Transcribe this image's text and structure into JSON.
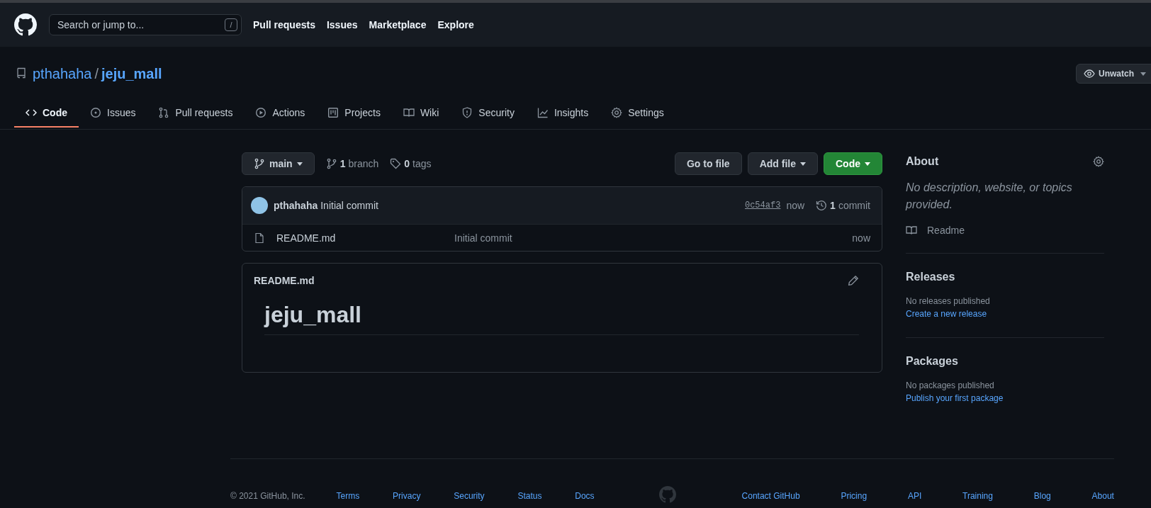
{
  "header": {
    "search": {
      "placeholder": "Search or jump to...",
      "key": "/"
    },
    "nav": [
      "Pull requests",
      "Issues",
      "Marketplace",
      "Explore"
    ]
  },
  "repo": {
    "owner": "pthahaha",
    "separator": "/",
    "name": "jeju_mall",
    "watch_button": "Unwatch"
  },
  "tabs": [
    {
      "label": "Code",
      "selected": true
    },
    {
      "label": "Issues",
      "selected": false
    },
    {
      "label": "Pull requests",
      "selected": false
    },
    {
      "label": "Actions",
      "selected": false
    },
    {
      "label": "Projects",
      "selected": false
    },
    {
      "label": "Wiki",
      "selected": false
    },
    {
      "label": "Security",
      "selected": false
    },
    {
      "label": "Insights",
      "selected": false
    },
    {
      "label": "Settings",
      "selected": false
    }
  ],
  "branch_bar": {
    "branch": "main",
    "branch_count": "1",
    "branch_label": "branch",
    "tag_count": "0",
    "tag_label": "tags",
    "buttons": [
      {
        "label": "Go to file",
        "kind": "plain"
      },
      {
        "label": "Add file",
        "kind": "dropdown"
      },
      {
        "label": "Code",
        "kind": "primary"
      }
    ]
  },
  "commit": {
    "author": "pthahaha",
    "message": "Initial commit",
    "sha": "0c54af3",
    "time": "now",
    "count": "1",
    "count_label": "commit"
  },
  "files": [
    {
      "name": "README.md",
      "message": "Initial commit",
      "time": "now"
    }
  ],
  "readme": {
    "filename": "README.md",
    "heading": "jeju_mall"
  },
  "sidebar": {
    "about": {
      "title": "About",
      "description": "No description, website, or topics provided.",
      "readme_link": "Readme"
    },
    "releases": {
      "title": "Releases",
      "text": "No releases published",
      "link": "Create a new release"
    },
    "packages": {
      "title": "Packages",
      "text": "No packages published",
      "link": "Publish your first package"
    }
  },
  "footer": {
    "copyright": "© 2021 GitHub, Inc.",
    "left_links": [
      "Terms",
      "Privacy",
      "Security",
      "Status",
      "Docs"
    ],
    "right_links": [
      "Contact GitHub",
      "Pricing",
      "API",
      "Training",
      "Blog",
      "About"
    ]
  }
}
